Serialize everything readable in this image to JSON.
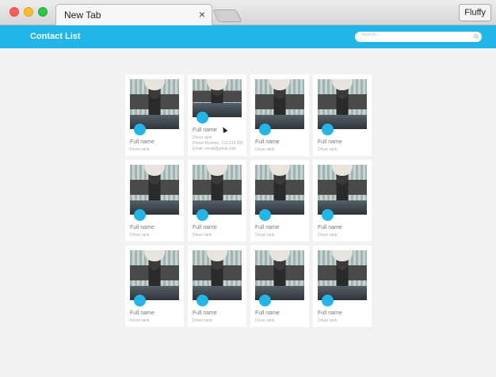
{
  "browser": {
    "tab_title": "New Tab",
    "tab_close": "×",
    "profile_label": "Fluffy"
  },
  "app": {
    "title": "Contact List",
    "search_placeholder": "search..."
  },
  "contacts": [
    {
      "name": "Full name",
      "rank": "Driver rank"
    },
    {
      "name": "Full name",
      "rank": "Driver rank",
      "phone": "Phone Number: 123.123.456",
      "email": "Email: email@gmail.com"
    },
    {
      "name": "Full name",
      "rank": "Driver rank"
    },
    {
      "name": "Full name",
      "rank": "Driver rank"
    },
    {
      "name": "Full name",
      "rank": "Driver rank"
    },
    {
      "name": "Full name",
      "rank": "Driver rank"
    },
    {
      "name": "Full name",
      "rank": "Driver rank"
    },
    {
      "name": "Full name",
      "rank": "Driver rank"
    },
    {
      "name": "Full name",
      "rank": "Driver rank"
    },
    {
      "name": "Full name",
      "rank": "Driver rank"
    },
    {
      "name": "Full name",
      "rank": "Driver rank"
    },
    {
      "name": "Full name",
      "rank": "Driver rank"
    }
  ],
  "colors": {
    "accent": "#21b5e8",
    "background": "#f2f2f2"
  }
}
